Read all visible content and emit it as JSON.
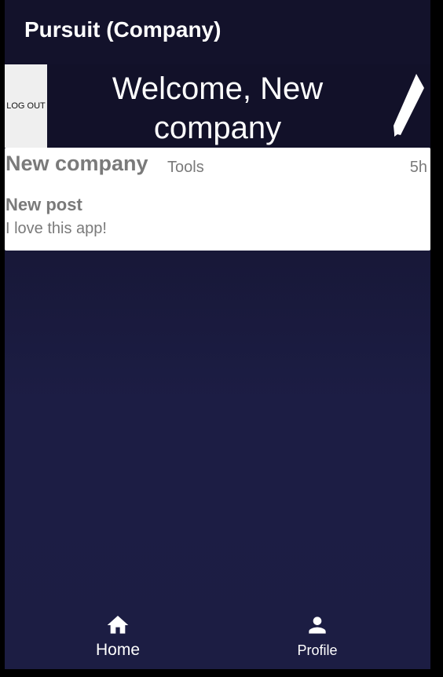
{
  "app_bar": {
    "title": "Pursuit (Company)"
  },
  "header": {
    "logout_label": "LOG OUT",
    "welcome_text": "Welcome, New company",
    "compose_icon": "pencil-icon"
  },
  "posts": [
    {
      "author": "New company",
      "category": "Tools",
      "time": "5h",
      "title": "New post",
      "body": "I love this app!"
    }
  ],
  "bottom_nav": {
    "items": [
      {
        "label": "Home",
        "icon": "home-icon"
      },
      {
        "label": "Profile",
        "icon": "person-icon"
      }
    ]
  },
  "colors": {
    "background": "#1c1d44",
    "app_bar": "#13122b",
    "card": "#ffffff",
    "card_text": "#7a7a7a",
    "logout_button": "#efefef"
  }
}
